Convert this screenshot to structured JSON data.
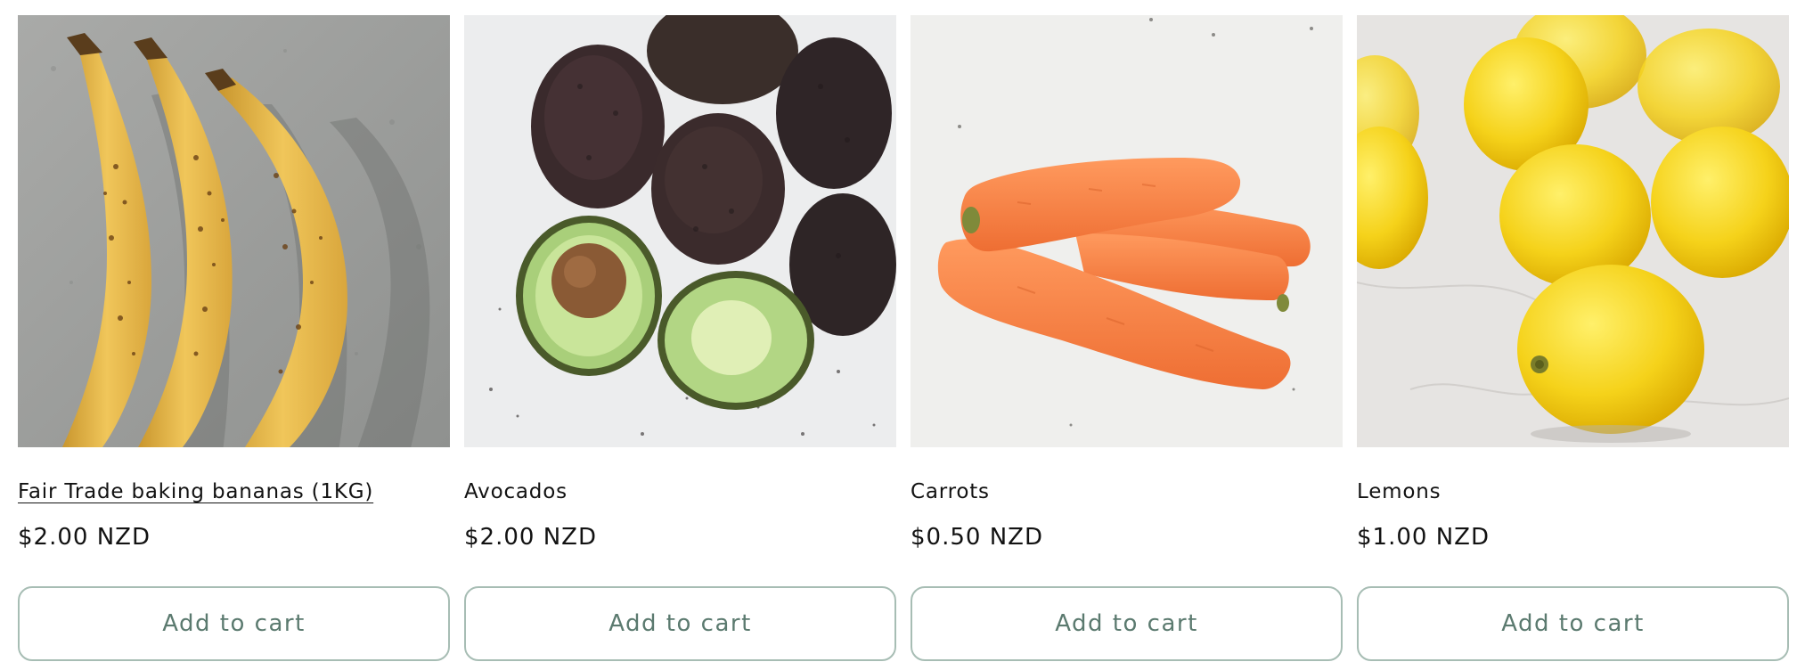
{
  "products": [
    {
      "title": "Fair Trade baking bananas (1KG)",
      "price": "$2.00 NZD",
      "button_label": "Add to cart",
      "image": "bananas-photo"
    },
    {
      "title": "Avocados",
      "price": "$2.00 NZD",
      "button_label": "Add to cart",
      "image": "avocados-photo"
    },
    {
      "title": "Carrots",
      "price": "$0.50 NZD",
      "button_label": "Add to cart",
      "image": "carrots-photo"
    },
    {
      "title": "Lemons",
      "price": "$1.00 NZD",
      "button_label": "Add to cart",
      "image": "lemons-photo"
    }
  ],
  "colors": {
    "button_border": "#a7bdb4",
    "button_text": "#5b7a6f",
    "text": "#121212"
  }
}
